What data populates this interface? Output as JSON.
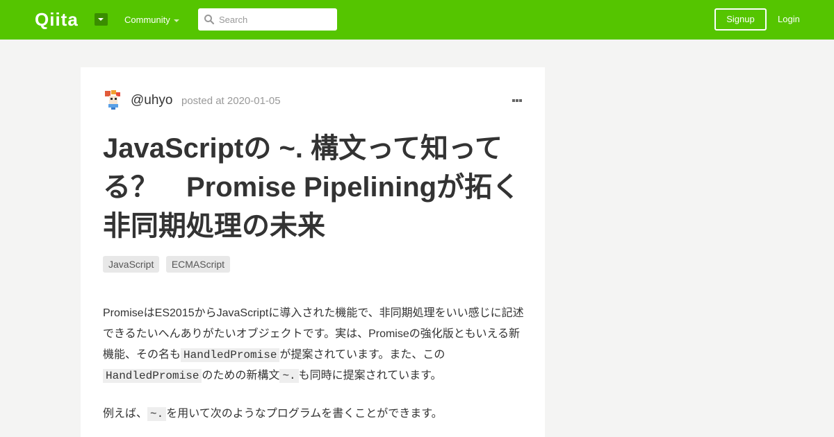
{
  "header": {
    "logo": "Qiita",
    "community_label": "Community",
    "search_placeholder": "Search",
    "signup_label": "Signup",
    "login_label": "Login",
    "brand_color": "#55c500"
  },
  "article": {
    "author": "@uhyo",
    "posted": "posted at 2020-01-05",
    "title": "JavaScriptの ~. 構文って知ってる？　Promise Pipeliningが拓く非同期処理の未来",
    "tags": [
      "JavaScript",
      "ECMAScript"
    ],
    "paragraph1": {
      "text1": "PromiseはES2015からJavaScriptに導入された機能で、非同期処理をいい感じに記述できるたいへんありがたいオブジェクトです。実は、Promiseの強化版ともいえる新機能、その名も",
      "code1": "HandledPromise",
      "text2": "が提案されています。また、この",
      "code2": "HandledPromise",
      "text3": "のための新構文",
      "code3": "~.",
      "text4": "も同時に提案されています。"
    },
    "paragraph2": {
      "text1": "例えば、",
      "code1": "~.",
      "text2": "を用いて次のようなプログラムを書くことができます。"
    }
  },
  "icons": [
    "dropdown-caret-icon",
    "search-icon",
    "more-options-icon",
    "avatar"
  ]
}
